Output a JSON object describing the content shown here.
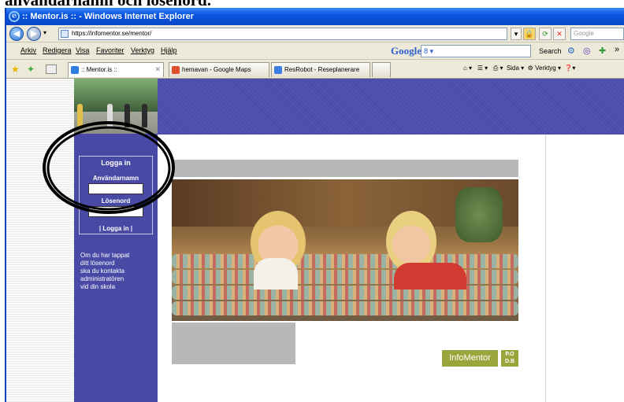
{
  "caption": "användarnamn och lösenord.",
  "window": {
    "title": ":: Mentor.is :: - Windows Internet Explorer"
  },
  "address": {
    "url": "https://infomentor.se/mentor/",
    "search_placeholder": "Google"
  },
  "menu": {
    "items": [
      "Arkiv",
      "Redigera",
      "Visa",
      "Favoriter",
      "Verktyg",
      "Hjälp"
    ],
    "google_label": "Google",
    "google_value": "8 ▾",
    "search_label": "Search"
  },
  "tabs": [
    {
      "label": ":: Mentor.is ::",
      "color": "#2f7de1"
    },
    {
      "label": "hemavan - Google Maps",
      "color": "#e0502d"
    },
    {
      "label": "ResRobot - Reseplanerare",
      "color": "#3c7de0"
    }
  ],
  "commands": {
    "page": "Sida",
    "tools": "Verktyg"
  },
  "login": {
    "title": "Logga in",
    "username_label": "Användarnamn",
    "password_label": "Lösenord",
    "button": "| Logga in |"
  },
  "help_text": "Om du har tappat\nditt lösenord\nska du kontakta\nadministratören\nvid din skola",
  "logo": {
    "text": "InfoMentor",
    "badge": "P.O\nD.B"
  },
  "colors": {
    "sidebar": "#484aa6",
    "brand": "#9aa63c"
  }
}
